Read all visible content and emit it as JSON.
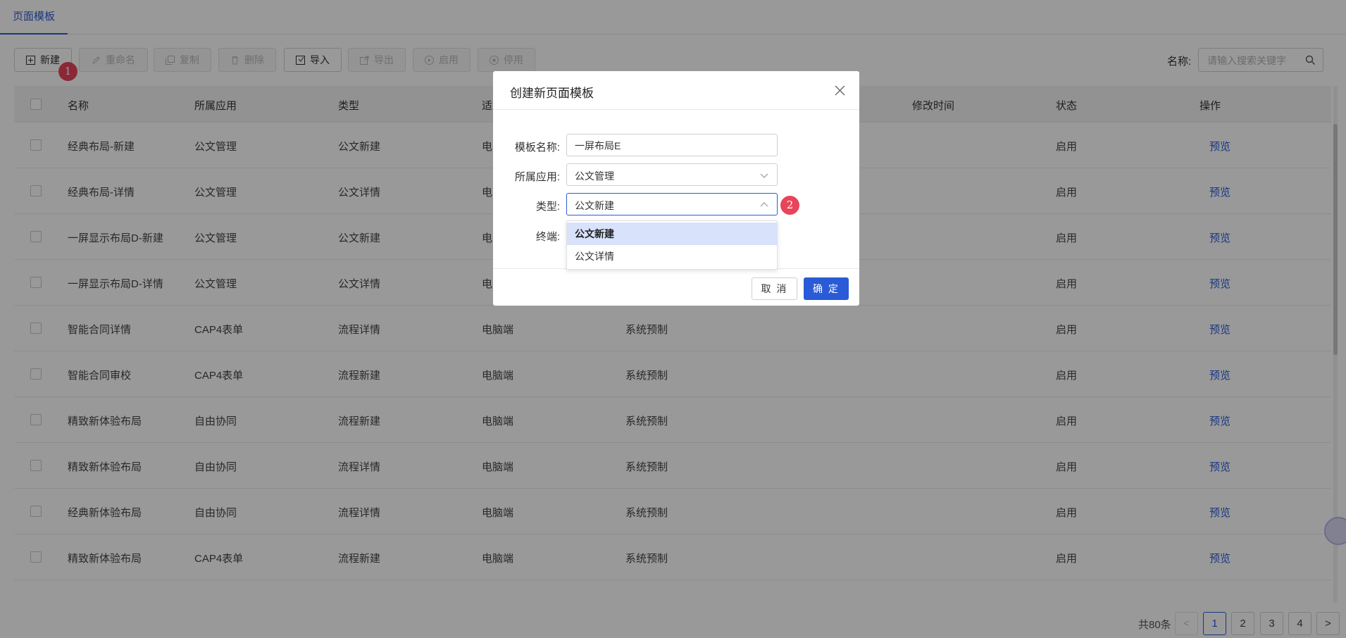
{
  "tab": {
    "label": "页面模板"
  },
  "toolbar": {
    "new": "新建",
    "rename": "重命名",
    "copy": "复制",
    "delete": "删除",
    "import": "导入",
    "export": "导出",
    "enable": "启用",
    "disable": "停用"
  },
  "steps": {
    "one": "1",
    "two": "2"
  },
  "search": {
    "label": "名称:",
    "placeholder": "请输入搜索关键字"
  },
  "table": {
    "headers": [
      "名称",
      "所属应用",
      "类型",
      "适",
      "修改时间",
      "状态",
      "操作"
    ],
    "rows": [
      {
        "name": "经典布局-新建",
        "app": "公文管理",
        "type": "公文新建",
        "terminal": "电",
        "source": "",
        "status": "启用",
        "action": "预览"
      },
      {
        "name": "经典布局-详情",
        "app": "公文管理",
        "type": "公文详情",
        "terminal": "电",
        "source": "",
        "status": "启用",
        "action": "预览"
      },
      {
        "name": "一屏显示布局D-新建",
        "app": "公文管理",
        "type": "公文新建",
        "terminal": "电",
        "source": "",
        "status": "启用",
        "action": "预览"
      },
      {
        "name": "一屏显示布局D-详情",
        "app": "公文管理",
        "type": "公文详情",
        "terminal": "电",
        "source": "",
        "status": "启用",
        "action": "预览"
      },
      {
        "name": "智能合同详情",
        "app": "CAP4表单",
        "type": "流程详情",
        "terminal": "电脑端",
        "source": "系统预制",
        "status": "启用",
        "action": "预览"
      },
      {
        "name": "智能合同审校",
        "app": "CAP4表单",
        "type": "流程新建",
        "terminal": "电脑端",
        "source": "系统预制",
        "status": "启用",
        "action": "预览"
      },
      {
        "name": "精致新体验布局",
        "app": "自由协同",
        "type": "流程新建",
        "terminal": "电脑端",
        "source": "系统预制",
        "status": "启用",
        "action": "预览"
      },
      {
        "name": "精致新体验布局",
        "app": "自由协同",
        "type": "流程详情",
        "terminal": "电脑端",
        "source": "系统预制",
        "status": "启用",
        "action": "预览"
      },
      {
        "name": "经典新体验布局",
        "app": "自由协同",
        "type": "流程详情",
        "terminal": "电脑端",
        "source": "系统预制",
        "status": "启用",
        "action": "预览"
      },
      {
        "name": "精致新体验布局",
        "app": "CAP4表单",
        "type": "流程新建",
        "terminal": "电脑端",
        "source": "系统预制",
        "status": "启用",
        "action": "预览"
      }
    ]
  },
  "pagination": {
    "total": "共80条",
    "prev": "<",
    "pages": [
      "1",
      "2",
      "3",
      "4"
    ],
    "next": ">",
    "current": "1"
  },
  "modal": {
    "title": "创建新页面模板",
    "fields": {
      "name_label": "模板名称:",
      "name_value": "一屏布局E",
      "app_label": "所属应用:",
      "app_value": "公文管理",
      "type_label": "类型:",
      "type_value": "公文新建",
      "terminal_label": "终端:"
    },
    "dropdown_options": [
      "公文新建",
      "公文详情"
    ],
    "dropdown_selected": "公文新建",
    "cancel": "取 消",
    "ok": "确 定"
  },
  "colors": {
    "accent": "#2a5bd7",
    "badge": "#e8445a",
    "overlay": "rgba(0,0,0,0.4)"
  }
}
